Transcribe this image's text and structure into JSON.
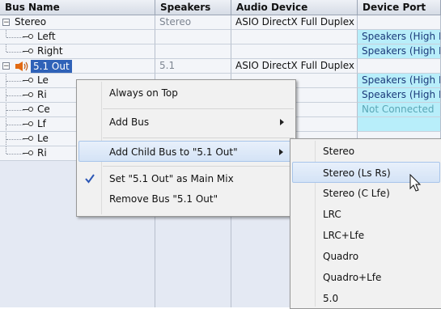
{
  "columns": [
    "Bus Name",
    "Speakers",
    "Audio Device",
    "Device Port"
  ],
  "rows": [
    {
      "name": "Stereo",
      "speakers": "Stereo",
      "device": "ASIO DirectX Full Duplex",
      "port": ""
    },
    {
      "name": "Left",
      "speakers": "",
      "device": "",
      "port": "Speakers (High D"
    },
    {
      "name": "Right",
      "speakers": "",
      "device": "",
      "port": "Speakers (High D"
    },
    {
      "name": "5.1 Out",
      "speakers": "5.1",
      "device": "ASIO DirectX Full Duplex",
      "port": ""
    },
    {
      "name": "Le",
      "speakers": "",
      "device": "",
      "port": "Speakers (High D"
    },
    {
      "name": "Ri",
      "speakers": "",
      "device": "",
      "port": "Speakers (High D"
    },
    {
      "name": "Ce",
      "speakers": "",
      "device": "",
      "port": "Not Connected"
    },
    {
      "name": "Lf",
      "speakers": "",
      "device": "",
      "port": ""
    },
    {
      "name": "Le",
      "speakers": "",
      "device": "",
      "port": ""
    },
    {
      "name": "Ri",
      "speakers": "",
      "device": "",
      "port": ""
    }
  ],
  "context_menu": {
    "always_on_top": "Always on Top",
    "add_bus": "Add Bus",
    "add_child_bus": "Add Child Bus to \"5.1 Out\"",
    "set_main_mix": "Set \"5.1 Out\" as Main Mix",
    "remove_bus": "Remove Bus \"5.1 Out\""
  },
  "submenu": [
    "Stereo",
    "Stereo (Ls Rs)",
    "Stereo (C Lfe)",
    "LRC",
    "LRC+Lfe",
    "Quadro",
    "Quadro+Lfe",
    "5.0"
  ],
  "submenu_highlighted": "Stereo (Ls Rs)",
  "tree_glyphs": {
    "expanded": "−"
  },
  "colors": {
    "port_bg": "#b8eefa",
    "selected_row": "#2f62b8",
    "highlight": "#d4e3f6"
  }
}
